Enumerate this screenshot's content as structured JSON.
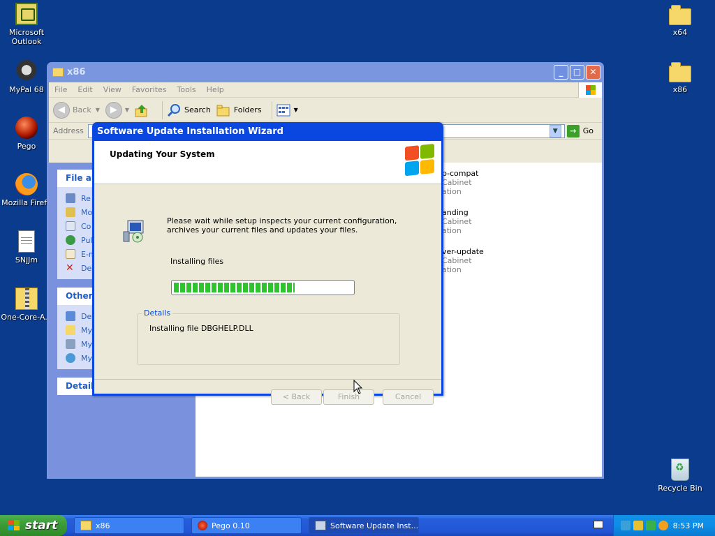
{
  "desktop_icons": [
    {
      "label": "Microsoft Outlook",
      "icon": "outlook-icon"
    },
    {
      "label": "MyPal 68",
      "icon": "mypal-icon"
    },
    {
      "label": "Pego",
      "icon": "pego-icon"
    },
    {
      "label": "Mozilla Firefo",
      "icon": "firefox-icon"
    },
    {
      "label": "SNjJm",
      "icon": "notepad-file-icon"
    },
    {
      "label": "One-Core-A...",
      "icon": "zip-folder-icon"
    },
    {
      "label": "x64",
      "icon": "folder-icon"
    },
    {
      "label": "x86",
      "icon": "folder-icon"
    },
    {
      "label": "Recycle Bin",
      "icon": "recycle-bin-icon"
    }
  ],
  "explorer": {
    "title": "x86",
    "menu": [
      "File",
      "Edit",
      "View",
      "Favorites",
      "Tools",
      "Help"
    ],
    "toolbar": {
      "back": "Back",
      "search": "Search",
      "folders": "Folders"
    },
    "address_label": "Address",
    "go_label": "Go",
    "taskpane": {
      "file_tasks_title": "File an",
      "file_tasks": [
        "Re",
        "Mo",
        "Co",
        "Pul",
        "E-m",
        "De"
      ],
      "other_places_title": "Other P",
      "other_places": [
        "De",
        "My",
        "My",
        "My"
      ],
      "details_title": "Details"
    },
    "files": [
      {
        "name": "p-compat",
        "type": "Cabinet",
        "desc": "ation"
      },
      {
        "name": "anding",
        "type": "Cabinet",
        "desc": "ation"
      },
      {
        "name": "ver-update",
        "type": "Cabinet",
        "desc": "ation"
      }
    ]
  },
  "wizard": {
    "title": "Software Update Installation Wizard",
    "heading": "Updating Your System",
    "message": "Please wait while setup inspects your current configuration, archives your current files and updates your files.",
    "status": "Installing files",
    "progress": 0.68,
    "details_legend": "Details",
    "details_text": "Installing file DBGHELP.DLL",
    "buttons": {
      "back": "< Back",
      "finish": "Finish",
      "cancel": "Cancel"
    }
  },
  "taskbar": {
    "start": "start",
    "buttons": [
      {
        "label": "x86",
        "icon": "folder-icon"
      },
      {
        "label": "Pego 0.10",
        "icon": "pego-icon"
      },
      {
        "label": "Software Update Inst...",
        "icon": "setup-icon",
        "active": true
      }
    ],
    "clock": "8:53 PM"
  }
}
